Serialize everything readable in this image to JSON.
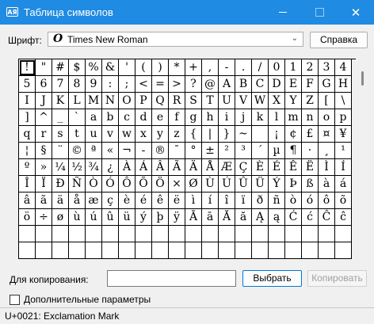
{
  "window": {
    "title": "Таблица символов",
    "app_icon_text": "AЯ",
    "controls": {
      "minimize": "minimize",
      "maximize": "maximize",
      "close": "✕"
    }
  },
  "font_row": {
    "label": "Шрифт:",
    "font_icon": "O",
    "selected_font": "Times New Roman",
    "dropdown_arrow": "⌄",
    "help_button": "Справка"
  },
  "grid": {
    "selected": "!",
    "rows": [
      [
        "!",
        "\"",
        "#",
        "$",
        "%",
        "&",
        "'",
        "(",
        ")",
        "*",
        "+",
        ",",
        "-",
        ".",
        "/",
        "0",
        "1",
        "2",
        "3",
        "4"
      ],
      [
        "5",
        "6",
        "7",
        "8",
        "9",
        ":",
        ";",
        "<",
        "=",
        ">",
        "?",
        "@",
        "A",
        "B",
        "C",
        "D",
        "E",
        "F",
        "G",
        "H"
      ],
      [
        "I",
        "J",
        "K",
        "L",
        "M",
        "N",
        "O",
        "P",
        "Q",
        "R",
        "S",
        "T",
        "U",
        "V",
        "W",
        "X",
        "Y",
        "Z",
        "[",
        "\\"
      ],
      [
        "]",
        "^",
        "_",
        "`",
        "a",
        "b",
        "c",
        "d",
        "e",
        "f",
        "g",
        "h",
        "i",
        "j",
        "k",
        "l",
        "m",
        "n",
        "o",
        "p"
      ],
      [
        "q",
        "r",
        "s",
        "t",
        "u",
        "v",
        "w",
        "x",
        "y",
        "z",
        "{",
        "|",
        "}",
        "~",
        " ",
        "¡",
        "¢",
        "£",
        "¤",
        "¥"
      ],
      [
        "¦",
        "§",
        "¨",
        "©",
        "ª",
        "«",
        "¬",
        "-",
        "®",
        "¯",
        "°",
        "±",
        "²",
        "³",
        "´",
        "µ",
        "¶",
        "·",
        "¸",
        "¹"
      ],
      [
        "º",
        "»",
        "¼",
        "½",
        "¾",
        "¿",
        "À",
        "Á",
        "Â",
        "Ã",
        "Ä",
        "Å",
        "Æ",
        "Ç",
        "È",
        "É",
        "Ê",
        "Ë",
        "Ì",
        "Í"
      ],
      [
        "Î",
        "Ï",
        "Ð",
        "Ñ",
        "Ò",
        "Ó",
        "Ô",
        "Õ",
        "Ö",
        "×",
        "Ø",
        "Ù",
        "Ú",
        "Û",
        "Ü",
        "Ý",
        "Þ",
        "ß",
        "à",
        "á"
      ],
      [
        "â",
        "ã",
        "ä",
        "å",
        "æ",
        "ç",
        "è",
        "é",
        "ê",
        "ë",
        "ì",
        "í",
        "î",
        "ï",
        "ð",
        "ñ",
        "ò",
        "ó",
        "ô",
        "õ"
      ],
      [
        "ö",
        "÷",
        "ø",
        "ù",
        "ú",
        "û",
        "ü",
        "ý",
        "þ",
        "ÿ",
        "Ā",
        "ā",
        "Ă",
        "ă",
        "Ą",
        "ą",
        "Ć",
        "ć",
        "Ĉ",
        "ĉ"
      ],
      [
        "",
        "",
        "",
        "",
        "",
        "",
        "",
        "",
        "",
        "",
        "",
        "",
        "",
        "",
        "",
        "",
        "",
        "",
        "",
        ""
      ],
      [
        "",
        "",
        "",
        "",
        "",
        "",
        "",
        "",
        "",
        "",
        "",
        "",
        "",
        "",
        "",
        "",
        "",
        "",
        "",
        ""
      ]
    ]
  },
  "copy_row": {
    "label": "Для копирования:",
    "value": "",
    "select_button": "Выбрать",
    "copy_button": "Копировать"
  },
  "advanced": {
    "label": "Дополнительные параметры",
    "checked": false
  },
  "status": {
    "text": "U+0021: Exclamation Mark"
  },
  "colors": {
    "titlebar": "#1f8be2",
    "window_bg": "#f0f0f0",
    "accent": "#0078d7"
  }
}
